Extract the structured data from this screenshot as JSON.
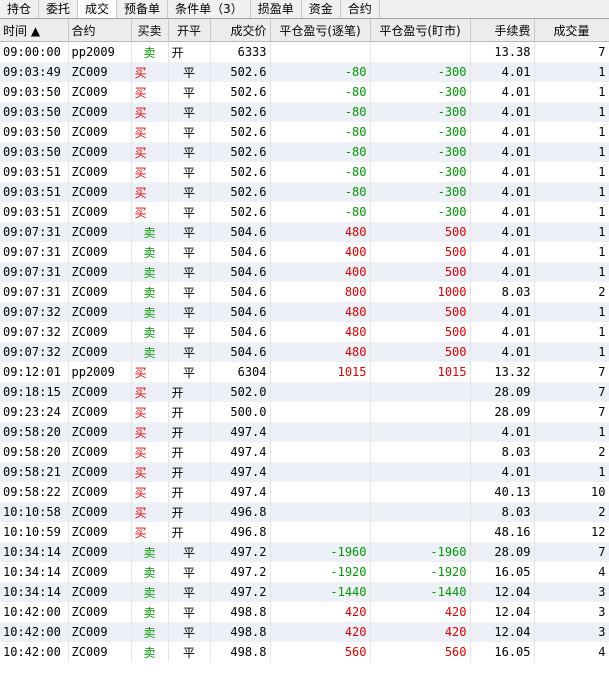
{
  "tabs": [
    {
      "label": "持仓",
      "active": false
    },
    {
      "label": "委托",
      "active": false
    },
    {
      "label": "成交",
      "active": true
    },
    {
      "label": "预备单",
      "active": false
    },
    {
      "label": "条件单（3）",
      "active": false
    },
    {
      "label": "损盈单",
      "active": false
    },
    {
      "label": "资金",
      "active": false
    },
    {
      "label": "合约",
      "active": false
    }
  ],
  "columns": [
    "时间 ▲",
    "合约",
    "买卖",
    "开平",
    "成交价",
    "平仓盈亏(逐笔)",
    "平仓盈亏(盯市)",
    "手续费",
    "成交量"
  ],
  "colors": {
    "buy": "#e00000",
    "sell": "#009900",
    "loss": "#009900",
    "profit": "#e00000"
  },
  "rows": [
    [
      "09:00:00",
      "pp2009",
      "卖",
      "开",
      "6333",
      "",
      "",
      "13.38",
      "7"
    ],
    [
      "09:03:49",
      "ZC009",
      "买",
      "平",
      "502.6",
      "-80",
      "-300",
      "4.01",
      "1"
    ],
    [
      "09:03:50",
      "ZC009",
      "买",
      "平",
      "502.6",
      "-80",
      "-300",
      "4.01",
      "1"
    ],
    [
      "09:03:50",
      "ZC009",
      "买",
      "平",
      "502.6",
      "-80",
      "-300",
      "4.01",
      "1"
    ],
    [
      "09:03:50",
      "ZC009",
      "买",
      "平",
      "502.6",
      "-80",
      "-300",
      "4.01",
      "1"
    ],
    [
      "09:03:50",
      "ZC009",
      "买",
      "平",
      "502.6",
      "-80",
      "-300",
      "4.01",
      "1"
    ],
    [
      "09:03:51",
      "ZC009",
      "买",
      "平",
      "502.6",
      "-80",
      "-300",
      "4.01",
      "1"
    ],
    [
      "09:03:51",
      "ZC009",
      "买",
      "平",
      "502.6",
      "-80",
      "-300",
      "4.01",
      "1"
    ],
    [
      "09:03:51",
      "ZC009",
      "买",
      "平",
      "502.6",
      "-80",
      "-300",
      "4.01",
      "1"
    ],
    [
      "09:07:31",
      "ZC009",
      "卖",
      "平",
      "504.6",
      "480",
      "500",
      "4.01",
      "1"
    ],
    [
      "09:07:31",
      "ZC009",
      "卖",
      "平",
      "504.6",
      "400",
      "500",
      "4.01",
      "1"
    ],
    [
      "09:07:31",
      "ZC009",
      "卖",
      "平",
      "504.6",
      "400",
      "500",
      "4.01",
      "1"
    ],
    [
      "09:07:31",
      "ZC009",
      "卖",
      "平",
      "504.6",
      "800",
      "1000",
      "8.03",
      "2"
    ],
    [
      "09:07:32",
      "ZC009",
      "卖",
      "平",
      "504.6",
      "480",
      "500",
      "4.01",
      "1"
    ],
    [
      "09:07:32",
      "ZC009",
      "卖",
      "平",
      "504.6",
      "480",
      "500",
      "4.01",
      "1"
    ],
    [
      "09:07:32",
      "ZC009",
      "卖",
      "平",
      "504.6",
      "480",
      "500",
      "4.01",
      "1"
    ],
    [
      "09:12:01",
      "pp2009",
      "买",
      "平",
      "6304",
      "1015",
      "1015",
      "13.32",
      "7"
    ],
    [
      "09:18:15",
      "ZC009",
      "买",
      "开",
      "502.0",
      "",
      "",
      "28.09",
      "7"
    ],
    [
      "09:23:24",
      "ZC009",
      "买",
      "开",
      "500.0",
      "",
      "",
      "28.09",
      "7"
    ],
    [
      "09:58:20",
      "ZC009",
      "买",
      "开",
      "497.4",
      "",
      "",
      "4.01",
      "1"
    ],
    [
      "09:58:20",
      "ZC009",
      "买",
      "开",
      "497.4",
      "",
      "",
      "8.03",
      "2"
    ],
    [
      "09:58:21",
      "ZC009",
      "买",
      "开",
      "497.4",
      "",
      "",
      "4.01",
      "1"
    ],
    [
      "09:58:22",
      "ZC009",
      "买",
      "开",
      "497.4",
      "",
      "",
      "40.13",
      "10"
    ],
    [
      "10:10:58",
      "ZC009",
      "买",
      "开",
      "496.8",
      "",
      "",
      "8.03",
      "2"
    ],
    [
      "10:10:59",
      "ZC009",
      "买",
      "开",
      "496.8",
      "",
      "",
      "48.16",
      "12"
    ],
    [
      "10:34:14",
      "ZC009",
      "卖",
      "平",
      "497.2",
      "-1960",
      "-1960",
      "28.09",
      "7"
    ],
    [
      "10:34:14",
      "ZC009",
      "卖",
      "平",
      "497.2",
      "-1920",
      "-1920",
      "16.05",
      "4"
    ],
    [
      "10:34:14",
      "ZC009",
      "卖",
      "平",
      "497.2",
      "-1440",
      "-1440",
      "12.04",
      "3"
    ],
    [
      "10:42:00",
      "ZC009",
      "卖",
      "平",
      "498.8",
      "420",
      "420",
      "12.04",
      "3"
    ],
    [
      "10:42:00",
      "ZC009",
      "卖",
      "平",
      "498.8",
      "420",
      "420",
      "12.04",
      "3"
    ],
    [
      "10:42:00",
      "ZC009",
      "卖",
      "平",
      "498.8",
      "560",
      "560",
      "16.05",
      "4"
    ]
  ]
}
